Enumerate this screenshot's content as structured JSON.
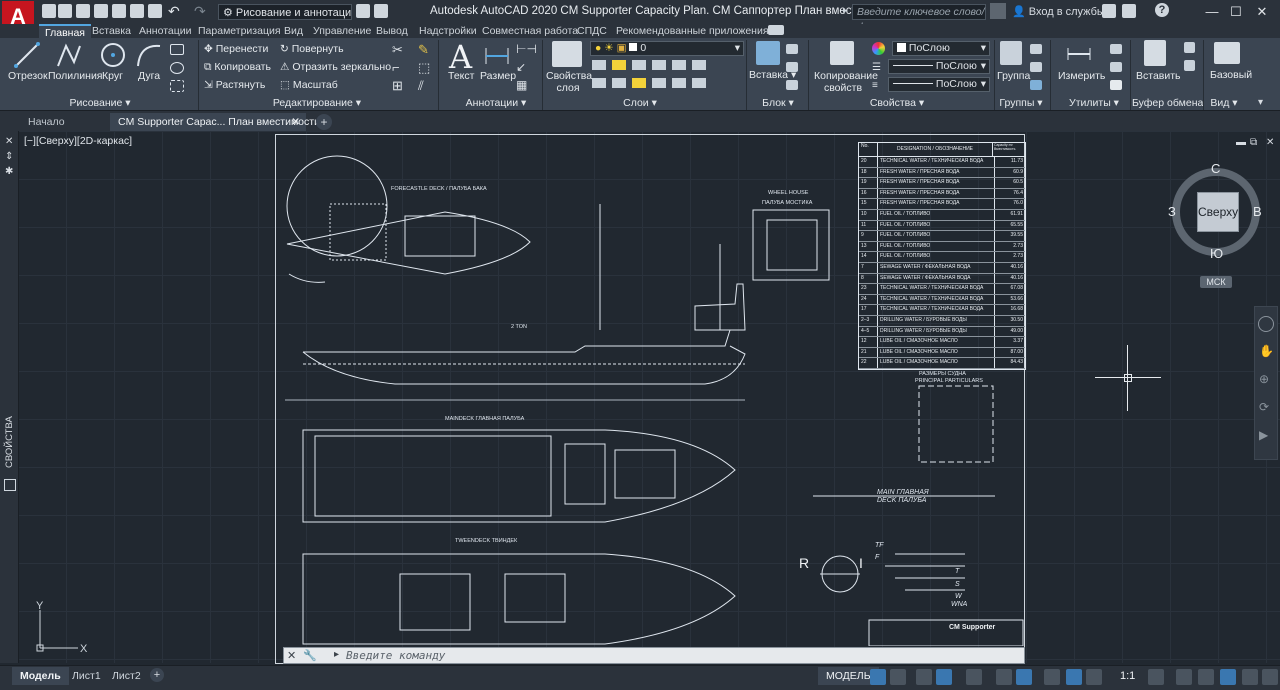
{
  "app": {
    "logo_letter": "A",
    "workspace": "Рисование и аннотации",
    "title": "Autodesk AutoCAD 2020   CM Supporter Capacity Plan. CM Саппортер План вместимости.dwg",
    "search_placeholder": "Введите ключевое слово/фразу",
    "signin": "Вход в службы",
    "accent": "#52a6e0",
    "brand": "#c6151f"
  },
  "ribbon_tabs": [
    "Главная",
    "Вставка",
    "Аннотации",
    "Параметризация",
    "Вид",
    "Управление",
    "Вывод",
    "Надстройки",
    "Совместная работа",
    "СПДС",
    "Рекомендованные приложения"
  ],
  "ribbon": {
    "draw": {
      "line": "Отрезок",
      "polyline": "Полилиния",
      "circle": "Круг",
      "arc": "Дуга",
      "title": "Рисование"
    },
    "modify": {
      "move": "Перенести",
      "rotate": "Повернуть",
      "copy": "Копировать",
      "mirror": "Отразить зеркально",
      "stretch": "Растянуть",
      "scale": "Масштаб",
      "title": "Редактирование"
    },
    "annotation": {
      "text": "Текст",
      "dimension": "Размер",
      "title": "Аннотации"
    },
    "layers": {
      "props": "Свойства слоя",
      "current": "0",
      "title": "Слои"
    },
    "block": {
      "insert": "Вставка",
      "title": "Блок"
    },
    "properties": {
      "match": "Копирование свойств",
      "color": "ПоСлою",
      "linetype": "ПоСлою",
      "lineweight": "ПоСлою",
      "title": "Свойства"
    },
    "groups": {
      "group": "Группа",
      "title": "Группы"
    },
    "utilities": {
      "measure": "Измерить",
      "title": "Утилиты"
    },
    "clipboard": {
      "paste": "Вставить",
      "title": "Буфер обмена"
    },
    "view": {
      "base": "Базовый",
      "title": "Вид"
    }
  },
  "doc_tabs": {
    "start": "Начало",
    "active": "CM Supporter Capac... План вместимости*"
  },
  "viewport_label": "[−][Сверху][2D-каркас]",
  "side_panel": "СВОЙСТВА",
  "viewcube": {
    "face": "Сверху",
    "north": "С",
    "south": "Ю",
    "west": "З",
    "east": "В",
    "wcs": "МСК"
  },
  "drawing": {
    "forecastle": "FORECASTLE DECK / ПАЛУБА БАКА",
    "wheelhouse": "WHEEL HOUSE",
    "wheelhouse_ru": "ПАЛУБА МОСТИКА",
    "maindeck": "MAINDECK   ГЛАВНАЯ ПАЛУБА",
    "tweendeck": "TWEENDECK   ТВИНДЕК",
    "main_deck_label": "MAIN   ГЛАВНАЯ",
    "deck_label": "DECK   ПАЛУБА",
    "title_block": "CM Supporter",
    "particulars_title": "РАЗМЕРЫ СУДНА",
    "particulars_sub": "PRINCIPAL PARTICULARS",
    "crane": "2 TON",
    "dims": [
      "TF",
      "F",
      "T",
      "S",
      "W",
      "WNA"
    ],
    "r_label": "R",
    "i_label": "I"
  },
  "tank_table": {
    "headers": [
      "No.",
      "DESIGNATION / ОБОЗНАЧЕНИЕ",
      "Capacity m³ Вместимость"
    ],
    "rows": [
      [
        "20",
        "TECHNICAL WATER / ТЕХНИЧЕСКАЯ ВОДА",
        "11.73"
      ],
      [
        "18",
        "FRESH WATER / ПРЕСНАЯ ВОДА",
        "60.9"
      ],
      [
        "19",
        "FRESH WATER / ПРЕСНАЯ ВОДА",
        "60.5"
      ],
      [
        "16",
        "FRESH WATER / ПРЕСНАЯ ВОДА",
        "76.4"
      ],
      [
        "15",
        "FRESH WATER / ПРЕСНАЯ ВОДА",
        "76.0"
      ],
      [
        "10",
        "FUEL OIL / ТОПЛИВО",
        "61.91"
      ],
      [
        "11",
        "FUEL OIL / ТОПЛИВО",
        "65.55"
      ],
      [
        "9",
        "FUEL OIL / ТОПЛИВО",
        "39.55"
      ],
      [
        "13",
        "FUEL OIL / ТОПЛИВО",
        "2.73"
      ],
      [
        "14",
        "FUEL OIL / ТОПЛИВО",
        "2.73"
      ],
      [
        "7",
        "SEWAGE WATER / ФЕКАЛЬНАЯ ВОДА",
        "40.16"
      ],
      [
        "8",
        "SEWAGE WATER / ФЕКАЛЬНАЯ ВОДА",
        "40.16"
      ],
      [
        "23",
        "TECHNICAL WATER / ТЕХНИЧЕСКАЯ ВОДА",
        "67.08"
      ],
      [
        "24",
        "TECHNICAL WATER / ТЕХНИЧЕСКАЯ ВОДА",
        "53.66"
      ],
      [
        "17",
        "TECHNICAL WATER / ТЕХНИЧЕСКАЯ ВОДА",
        "16.68"
      ],
      [
        "2–3",
        "DRILLING WATER / БУРОВЫЕ ВОДЫ",
        "30.50"
      ],
      [
        "4–5",
        "DRILLING WATER / БУРОВЫЕ ВОДЫ",
        "49.00"
      ],
      [
        "12",
        "LUBE OIL / СМАЗОЧНОЕ МАСЛО",
        "3.37"
      ],
      [
        "21",
        "LUBE OIL / СМАЗОЧНОЕ МАСЛО",
        "87.00"
      ],
      [
        "22",
        "LUBE OIL / СМАЗОЧНОЕ МАСЛО",
        "84.43"
      ]
    ]
  },
  "command": {
    "placeholder": "Введите команду"
  },
  "status": {
    "model_tab": "Модель",
    "sheet1": "Лист1",
    "sheet2": "Лист2",
    "model_btn": "МОДЕЛЬ",
    "scale": "1:1"
  },
  "axes": {
    "x": "X",
    "y": "Y"
  }
}
